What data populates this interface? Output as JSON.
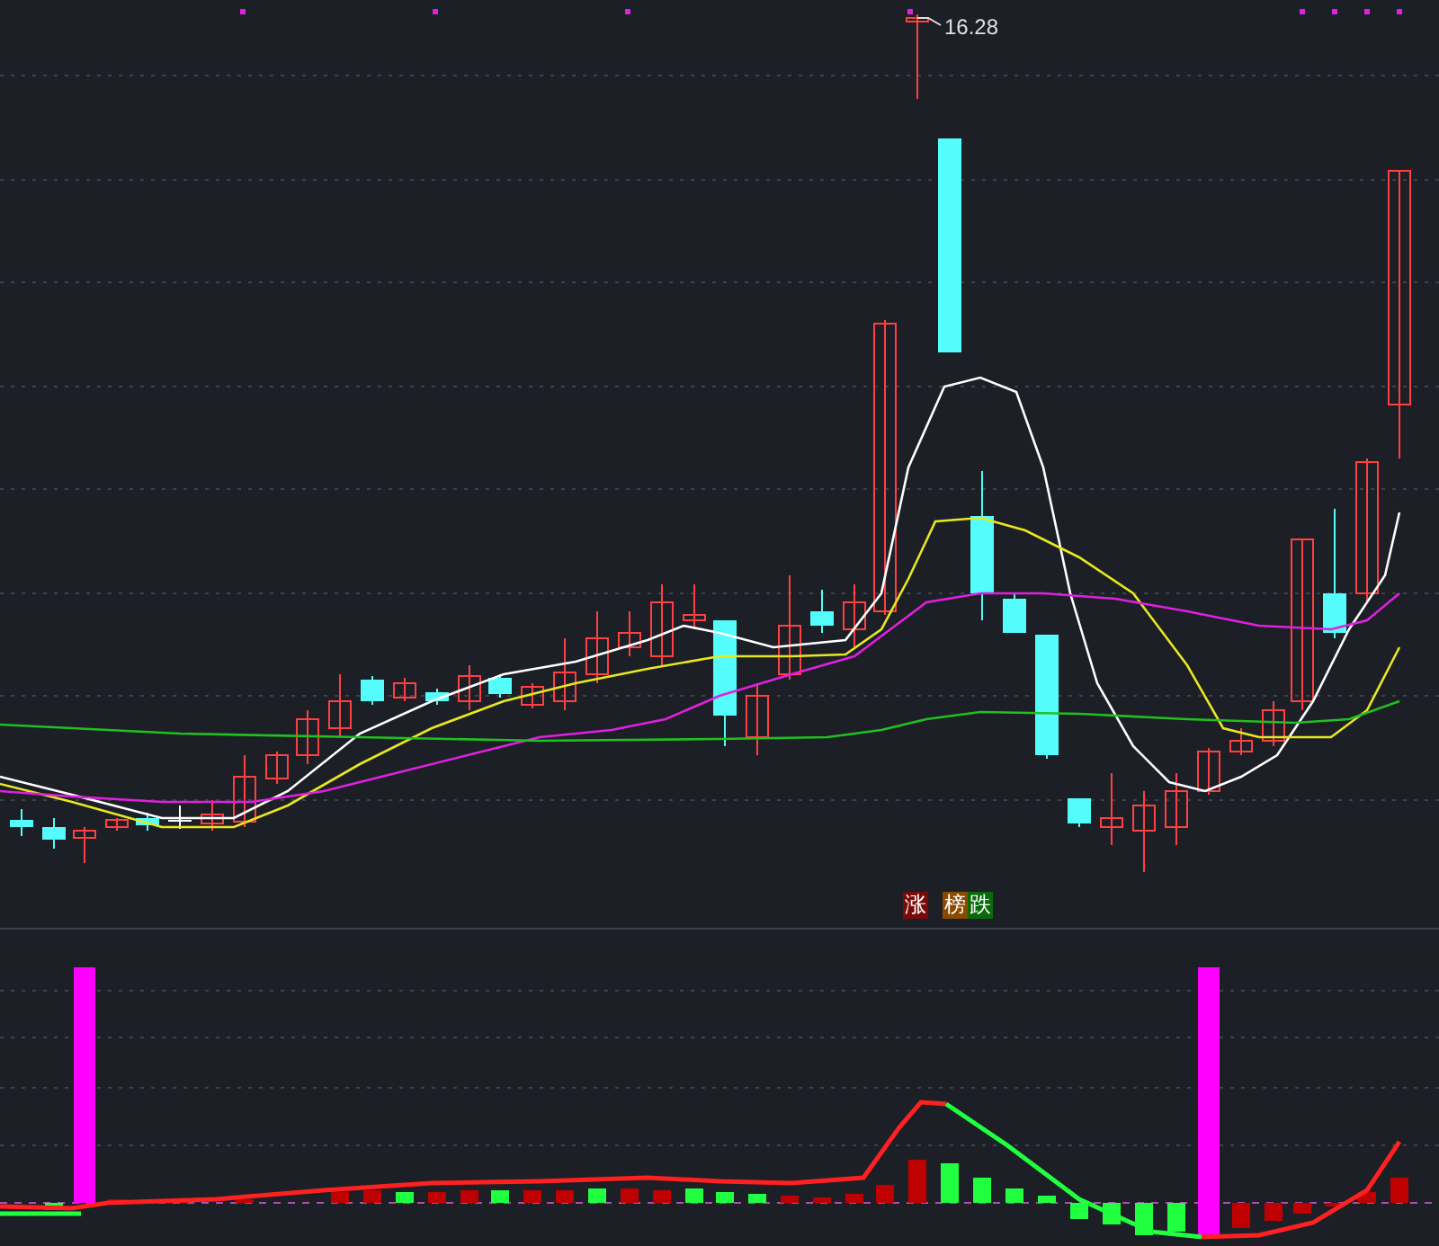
{
  "price_chart": {
    "high_label": "16.28",
    "tags": [
      {
        "text": "涨",
        "color": "#7a0a0a"
      },
      {
        "text": "榜",
        "color": "#8a4a00"
      },
      {
        "text": "跌",
        "color": "#0a6a0a"
      }
    ]
  }
}
